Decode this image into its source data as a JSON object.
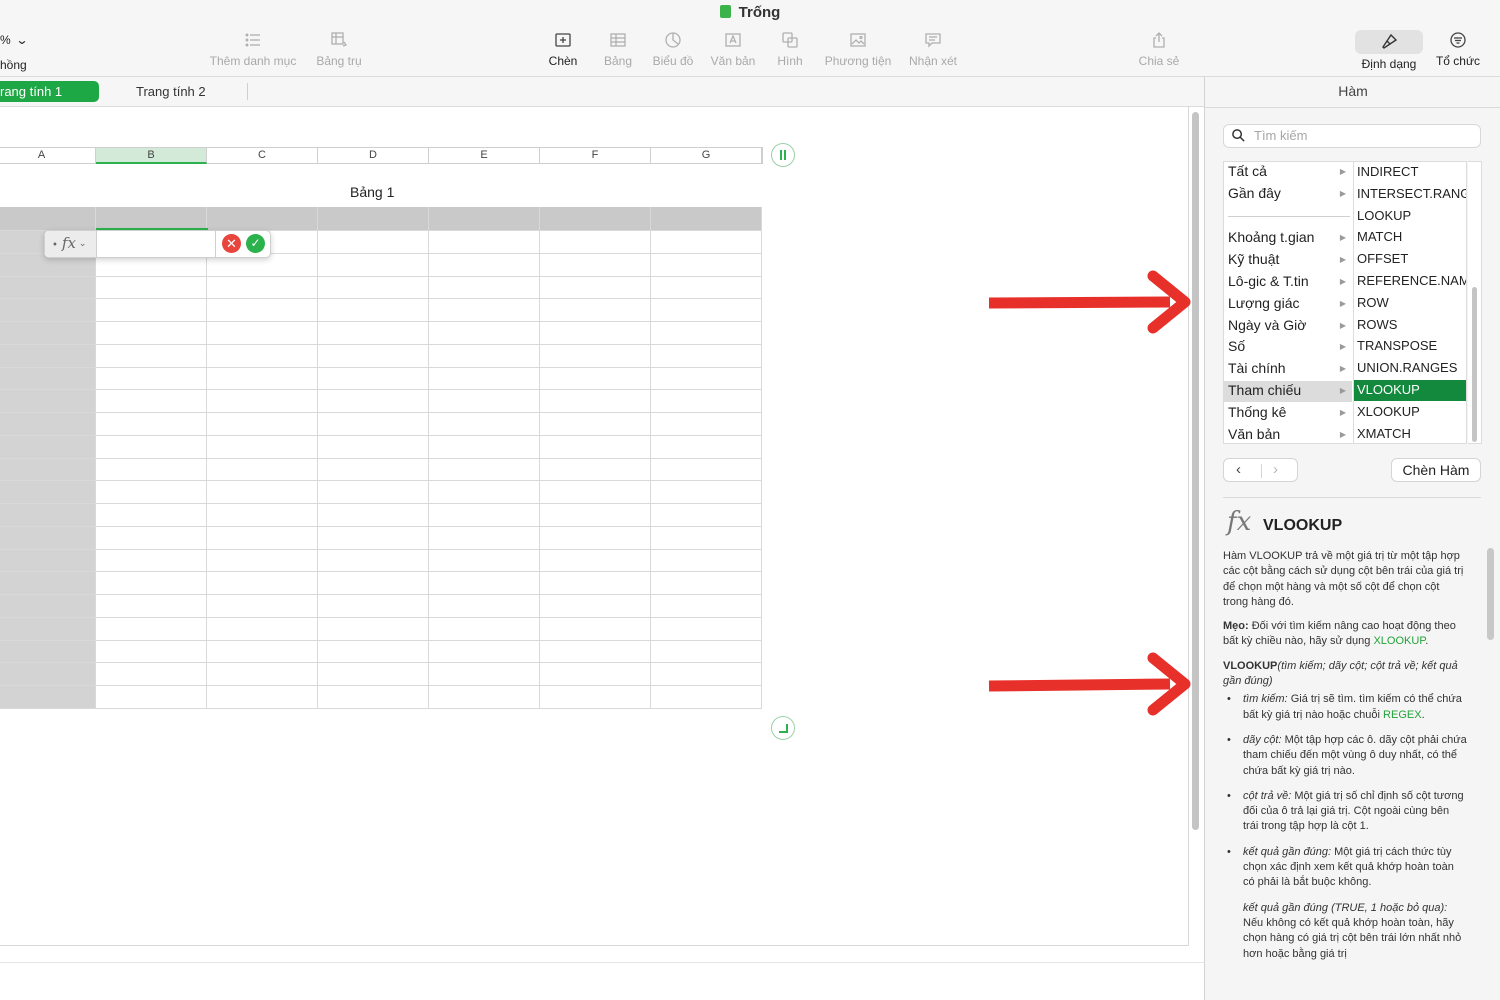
{
  "window": {
    "title": "Trống"
  },
  "toolbar": {
    "zoom_value": "%",
    "zoom_label": "hồng",
    "items": [
      {
        "label": "Thêm danh mục",
        "icon": "list-icon",
        "enabled": false
      },
      {
        "label": "Bảng trụ",
        "icon": "pivot-table-icon",
        "enabled": false
      },
      {
        "label": "Chèn",
        "icon": "insert-icon",
        "enabled": true
      },
      {
        "label": "Bảng",
        "icon": "table-icon",
        "enabled": false
      },
      {
        "label": "Biểu đồ",
        "icon": "chart-icon",
        "enabled": false
      },
      {
        "label": "Văn bản",
        "icon": "text-box-icon",
        "enabled": false
      },
      {
        "label": "Hình",
        "icon": "shape-icon",
        "enabled": false
      },
      {
        "label": "Phương tiện",
        "icon": "media-icon",
        "enabled": false
      },
      {
        "label": "Nhận xét",
        "icon": "comment-icon",
        "enabled": false
      },
      {
        "label": "Chia sẻ",
        "icon": "share-icon",
        "enabled": false
      },
      {
        "label": "Định dạng",
        "icon": "format-brush-icon",
        "enabled": true
      },
      {
        "label": "Tổ chức",
        "icon": "organize-icon",
        "enabled": true
      }
    ]
  },
  "sheets": {
    "tab1": "rang tính 1",
    "tab2": "Trang tính 2"
  },
  "table": {
    "title": "Bảng 1",
    "columns": [
      "A",
      "B",
      "C",
      "D",
      "E",
      "F",
      "G"
    ],
    "selected_column": "B"
  },
  "formula_editor": {
    "fx": "fx",
    "chevron": "⌄",
    "cancel": "✕",
    "confirm": "✓"
  },
  "sidebar": {
    "title": "Hàm",
    "search_placeholder": "Tìm kiếm",
    "categories": [
      "Tất cả",
      "Gần đây",
      "Khoảng t.gian",
      "Kỹ thuật",
      "Lô-gic & T.tin",
      "Lượng giác",
      "Ngày và Giờ",
      "Số",
      "Tài chính",
      "Tham chiếu",
      "Thống kê",
      "Văn bản"
    ],
    "selected_category": "Tham chiếu",
    "functions": [
      "INDIRECT",
      "INTERSECT.RANGES",
      "LOOKUP",
      "MATCH",
      "OFFSET",
      "REFERENCE.NAME",
      "ROW",
      "ROWS",
      "TRANSPOSE",
      "UNION.RANGES",
      "VLOOKUP",
      "XLOOKUP",
      "XMATCH"
    ],
    "selected_function": "VLOOKUP",
    "nav_prev": "‹",
    "nav_next": "›",
    "insert_button": "Chèn Hàm",
    "detail": {
      "fx": "fx",
      "name": "VLOOKUP",
      "summary": "Hàm VLOOKUP trả về một giá trị từ một tập hợp các cột bằng cách sử dụng cột bên trái của giá trị để chọn một hàng và một số cột để chọn cột trong hàng đó.",
      "tip_label": "Mẹo:",
      "tip_text": "Đối với tìm kiếm nâng cao hoạt động theo bất kỳ chiều nào, hãy sử dụng",
      "tip_link": "XLOOKUP",
      "tip_end": ".",
      "syntax_name": "VLOOKUP",
      "syntax_args": "(tìm kiếm; dãy cột; cột trả về; kết quả gần đúng)",
      "params": [
        {
          "name": "tìm kiếm:",
          "text": "Giá trị sẽ tìm. tìm kiếm có thể chứa bất kỳ giá trị nào hoặc chuỗi",
          "link": "REGEX",
          "end": "."
        },
        {
          "name": "dãy cột:",
          "text": "Một tập hợp các ô. dãy cột phải chứa tham chiếu đến một vùng ô duy nhất, có thể chứa bất kỳ giá trị nào.",
          "link": "",
          "end": ""
        },
        {
          "name": "cột trả về:",
          "text": "Một giá trị số chỉ định số cột tương đối của ô trả lại giá trị. Cột ngoài cùng bên trái trong tập hợp là cột 1.",
          "link": "",
          "end": ""
        },
        {
          "name": "kết quả gần đúng:",
          "text": "Một giá trị cách thức tùy chọn xác định xem kết quả khớp hoàn toàn có phải là bắt buộc không.",
          "link": "",
          "end": ""
        },
        {
          "name": "kết quả gần đúng (TRUE, 1 hoặc bỏ qua):",
          "text": "Nếu không có kết quả khớp hoàn toàn, hãy chọn hàng có giá trị cột bên trái lớn nhất nhỏ hơn hoặc bằng giá trị",
          "link": "",
          "end": ""
        }
      ]
    }
  },
  "colors": {
    "accent": "#1ea745",
    "selected_function_bg": "#12893c",
    "annotation_arrow": "#e8302a",
    "link": "#22a33a"
  }
}
